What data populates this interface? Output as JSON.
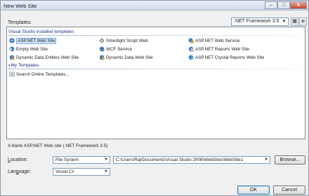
{
  "window": {
    "title": "New Web Site",
    "controls": {
      "minimize": "–",
      "maximize": "□",
      "close": "X"
    }
  },
  "templates_section": {
    "label": "Templates:",
    "framework_selected": ".NET Framework 3.5"
  },
  "groups": {
    "installed": {
      "header": "Visual Studio installed templates"
    },
    "my": {
      "header": "My Templates"
    }
  },
  "installed_templates": [
    {
      "label": "ASP.NET Web Site",
      "icon": "aspnet-web-site-icon"
    },
    {
      "label": "Silverlight Script Web",
      "icon": "silverlight-icon"
    },
    {
      "label": "ASP.NET Web Service",
      "icon": "web-service-icon"
    },
    {
      "label": "Empty Web Site",
      "icon": "empty-web-site-icon"
    },
    {
      "label": "WCF Service",
      "icon": "wcf-service-icon"
    },
    {
      "label": "ASP.NET Reports Web Site",
      "icon": "reports-web-site-icon"
    },
    {
      "label": "Dynamic Data Entities Web Site",
      "icon": "dynamic-data-entities-icon"
    },
    {
      "label": "Dynamic Data Web Site",
      "icon": "dynamic-data-web-site-icon"
    },
    {
      "label": "ASP.NET Crystal Reports Web Site",
      "icon": "crystal-reports-icon"
    }
  ],
  "my_templates": [
    {
      "label": "Search Online Templates...",
      "icon": "search-online-icon"
    }
  ],
  "description": "A blank ASP.NET Web site (.NET Framework 3.5)",
  "location": {
    "label": "Location:",
    "type": "File System",
    "path": "C:\\Users\\Raj\\Documents\\Visual Studio 2008\\WebSites\\WebSite1",
    "browse": "Browse..."
  },
  "language": {
    "label": "Language:",
    "value": "Visual C#"
  },
  "buttons": {
    "ok": "OK",
    "cancel": "Cancel"
  },
  "colors": {
    "selection": "#cfe4fa",
    "group_header": "#1e3287",
    "dialog_bg": "#f0f0f0"
  }
}
